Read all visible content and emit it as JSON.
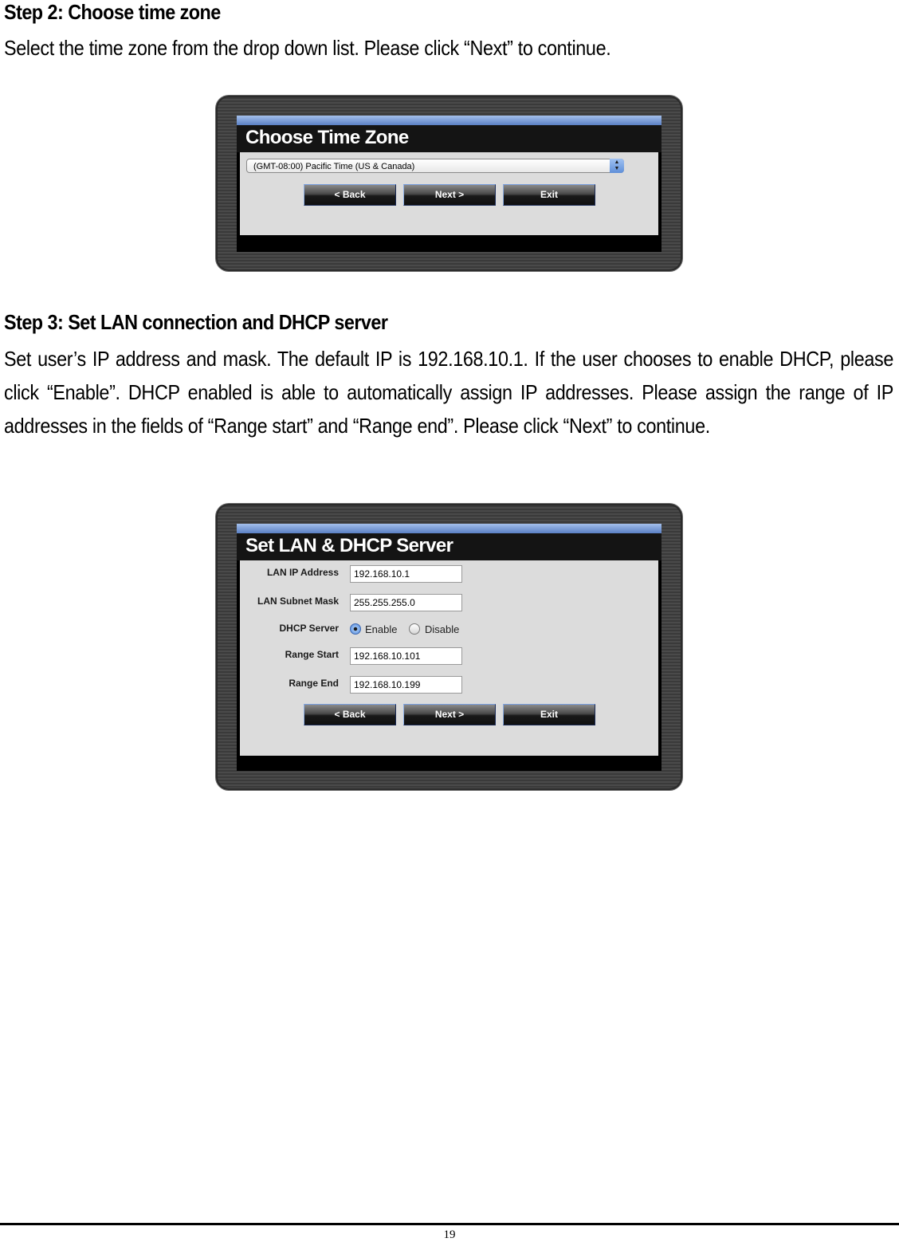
{
  "step2": {
    "heading": "Step 2: Choose time zone",
    "paragraph": "Select the time zone from the drop down list. Please click “Next” to continue.",
    "screenshot": {
      "title": "Choose Time Zone",
      "timezone_select": {
        "selected": "(GMT-08:00) Pacific Time (US & Canada)",
        "icon": "updown-arrows-icon"
      },
      "buttons": {
        "back": "< Back",
        "next": "Next >",
        "exit": "Exit"
      }
    }
  },
  "step3": {
    "heading": "Step 3: Set LAN connection and DHCP server",
    "paragraph": "Set user’s IP address and mask. The default IP is 192.168.10.1. If the user chooses to enable DHCP, please click “Enable”. DHCP enabled is able to automatically assign IP addresses. Please assign the range of IP addresses in the fields of “Range start” and “Range end”. Please click “Next” to continue.",
    "screenshot": {
      "title": "Set LAN & DHCP Server",
      "fields": {
        "lan_ip": {
          "label": "LAN IP Address",
          "value": "192.168.10.1"
        },
        "subnet": {
          "label": "LAN Subnet Mask",
          "value": "255.255.255.0"
        },
        "dhcp": {
          "label": "DHCP Server",
          "enable": "Enable",
          "disable": "Disable",
          "selected": "Enable"
        },
        "range_start": {
          "label": "Range Start",
          "value": "192.168.10.101"
        },
        "range_end": {
          "label": "Range End",
          "value": "192.168.10.199"
        }
      },
      "buttons": {
        "back": "< Back",
        "next": "Next >",
        "exit": "Exit"
      }
    }
  },
  "footer": {
    "page_number": "19"
  }
}
